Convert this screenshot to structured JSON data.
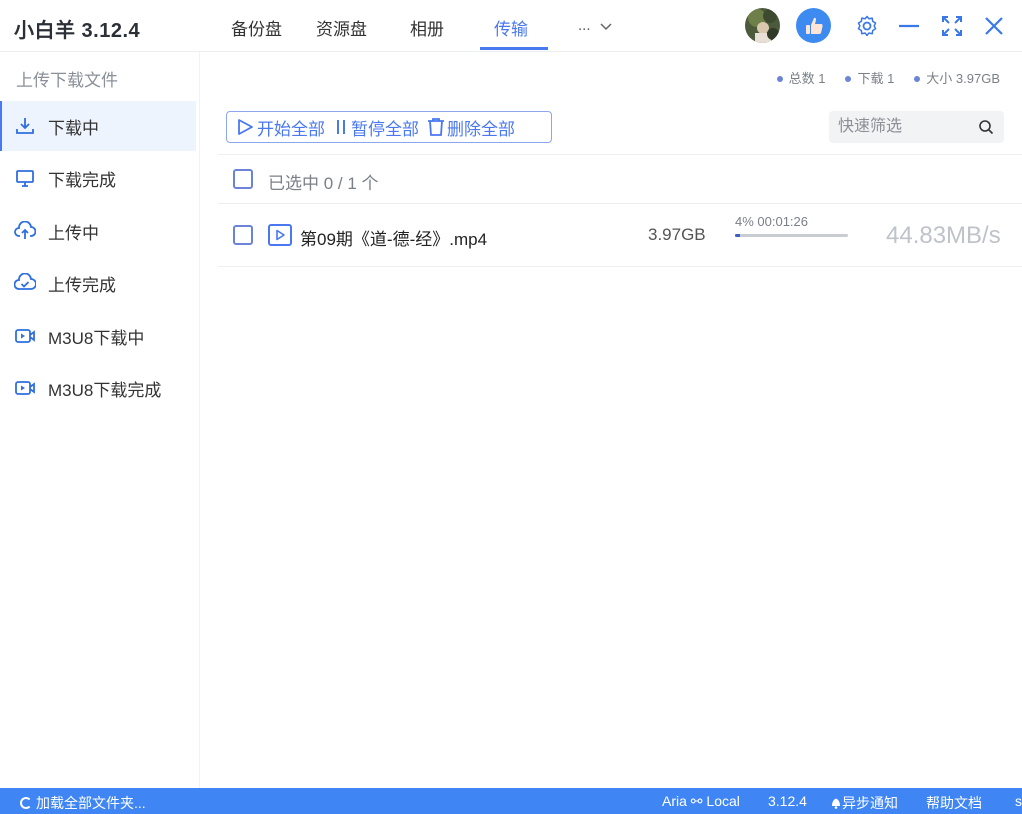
{
  "app": {
    "title": "小白羊 3.12.4"
  },
  "nav": {
    "tabs": [
      {
        "label": "备份盘"
      },
      {
        "label": "资源盘"
      },
      {
        "label": "相册"
      },
      {
        "label": "传输"
      }
    ],
    "active_tab": "传输",
    "more_label": "..."
  },
  "header_icons": [
    "avatar",
    "thumbs-up-icon",
    "gear-icon",
    "minimize-icon",
    "fullscreen-icon",
    "close-icon"
  ],
  "sidebar": {
    "heading": "上传下载文件",
    "items": [
      {
        "label": "下载中",
        "icon": "download-icon",
        "active": true
      },
      {
        "label": "下载完成",
        "icon": "monitor-icon",
        "active": false
      },
      {
        "label": "上传中",
        "icon": "cloud-upload-icon",
        "active": false
      },
      {
        "label": "上传完成",
        "icon": "cloud-check-icon",
        "active": false
      },
      {
        "label": "M3U8下载中",
        "icon": "video-icon",
        "active": false
      },
      {
        "label": "M3U8下载完成",
        "icon": "video-icon",
        "active": false
      }
    ]
  },
  "stats": {
    "total": "总数 1",
    "download": "下载 1",
    "size": "大小 3.97GB"
  },
  "toolbar": {
    "start_all": "开始全部",
    "pause_all": "暂停全部",
    "delete_all": "删除全部"
  },
  "filter": {
    "placeholder": "快速筛选"
  },
  "selection": {
    "text": "已选中 0 / 1 个"
  },
  "files": [
    {
      "name": "第09期《道-德-经》.mp4",
      "size": "3.97GB",
      "progress_label": "4% 00:01:26",
      "progress": 0.04,
      "speed": "44.83MB/s"
    }
  ],
  "statusbar": {
    "loading": "加载全部文件夹...",
    "engine": "Aria ⚯ Local",
    "version": "3.12.4",
    "notify": "异步通知",
    "help": "帮助文档",
    "edge": "s"
  },
  "colors": {
    "accent": "#4a78f0",
    "statusbar": "#3f86f4",
    "active_bg": "#eef4fe"
  }
}
